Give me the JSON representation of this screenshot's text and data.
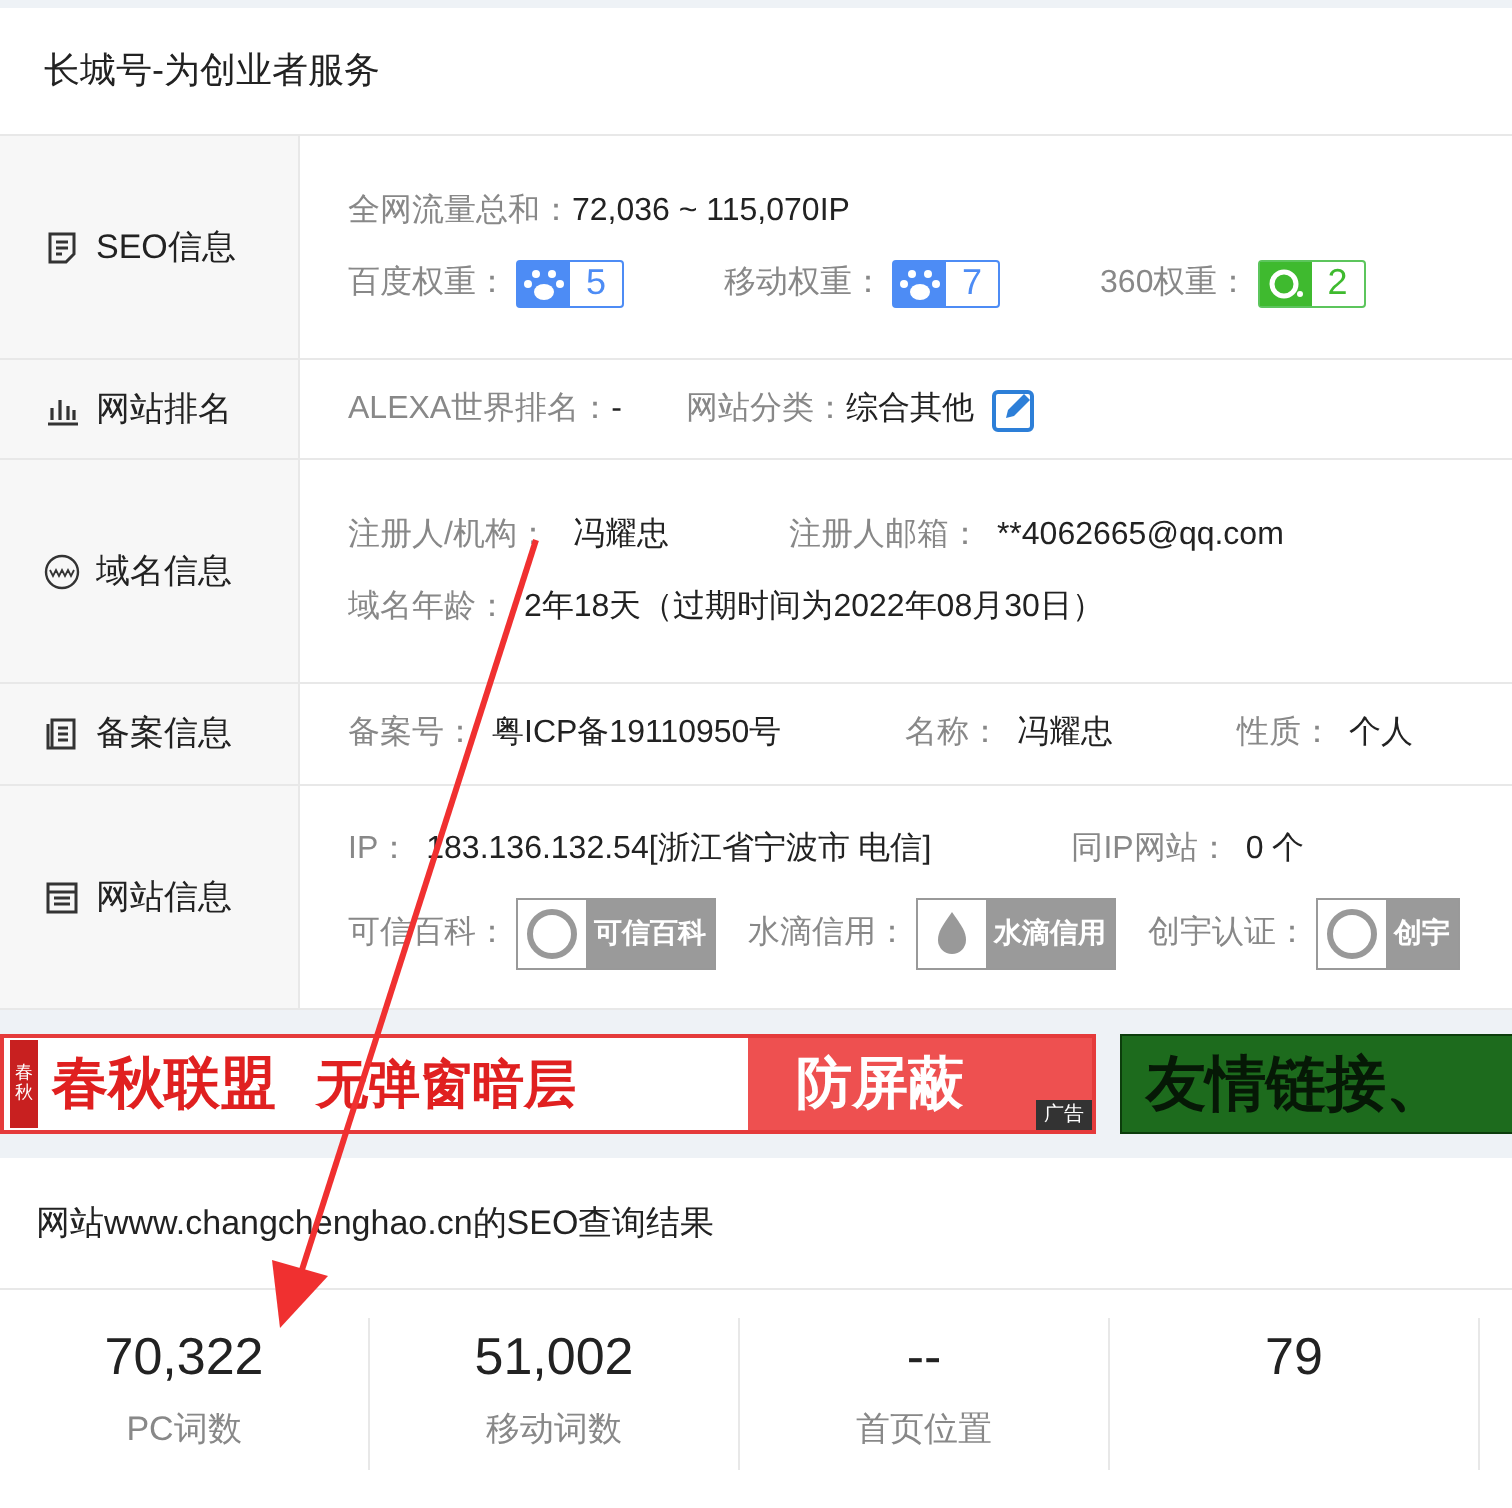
{
  "header": {
    "title": "长城号-为创业者服务"
  },
  "rows": [
    {
      "kind": "seo",
      "label": "SEO信息",
      "traffic_label": "全网流量总和：",
      "traffic_value": "72,036 ~ 115,070IP",
      "weights": [
        {
          "label": "百度权重：",
          "value": "5",
          "kind": "baidu"
        },
        {
          "label": "移动权重：",
          "value": "7",
          "kind": "mobile"
        },
        {
          "label": "360权重：",
          "value": "2",
          "kind": "green"
        }
      ]
    },
    {
      "kind": "rank",
      "label": "网站排名",
      "alexa_label": "ALEXA世界排名：",
      "alexa_value": "-",
      "category_label": "网站分类：",
      "category_value": "综合其他"
    },
    {
      "kind": "domain",
      "label": "域名信息",
      "registrant_label": "注册人/机构：",
      "registrant_value": "冯耀忠",
      "email_label": "注册人邮箱：",
      "email_value": "**4062665@qq.com",
      "age_label": "域名年龄：",
      "age_value": "2年18天（过期时间为2022年08月30日）"
    },
    {
      "kind": "icp",
      "label": "备案信息",
      "fields": [
        {
          "label": "备案号：",
          "value": "粤ICP备19110950号"
        },
        {
          "label": "名称：",
          "value": "冯耀忠"
        },
        {
          "label": "性质：",
          "value": "个人"
        }
      ]
    },
    {
      "kind": "site",
      "label": "网站信息",
      "ip_label": "IP：",
      "ip_value": "183.136.132.54[浙江省宁波市 电信]",
      "same_ip_label": "同IP网站：",
      "same_ip_value": "0 个",
      "certs": [
        {
          "label": "可信百科：",
          "badge": "可信百科",
          "kind": "kexin"
        },
        {
          "label": "水滴信用：",
          "badge": "水滴信用",
          "kind": "shuidi"
        },
        {
          "label": "创宇认证：",
          "badge": "创宇",
          "kind": "chuangyu"
        }
      ]
    }
  ],
  "banners": [
    {
      "kind": "red",
      "seal": "春秋",
      "text_1": "春秋联盟",
      "text_2": "无弹窗暗层",
      "text_3": "防屏蔽",
      "tag": "广告"
    },
    {
      "kind": "green",
      "text_1": "友情链接、"
    }
  ],
  "result": {
    "title": "网站www.changchenghao.cn的SEO查询结果",
    "stats": [
      {
        "value": "70,322",
        "label": "PC词数"
      },
      {
        "value": "51,002",
        "label": "移动词数"
      },
      {
        "value": "--",
        "label": "首页位置"
      },
      {
        "value": "79"
      }
    ]
  }
}
